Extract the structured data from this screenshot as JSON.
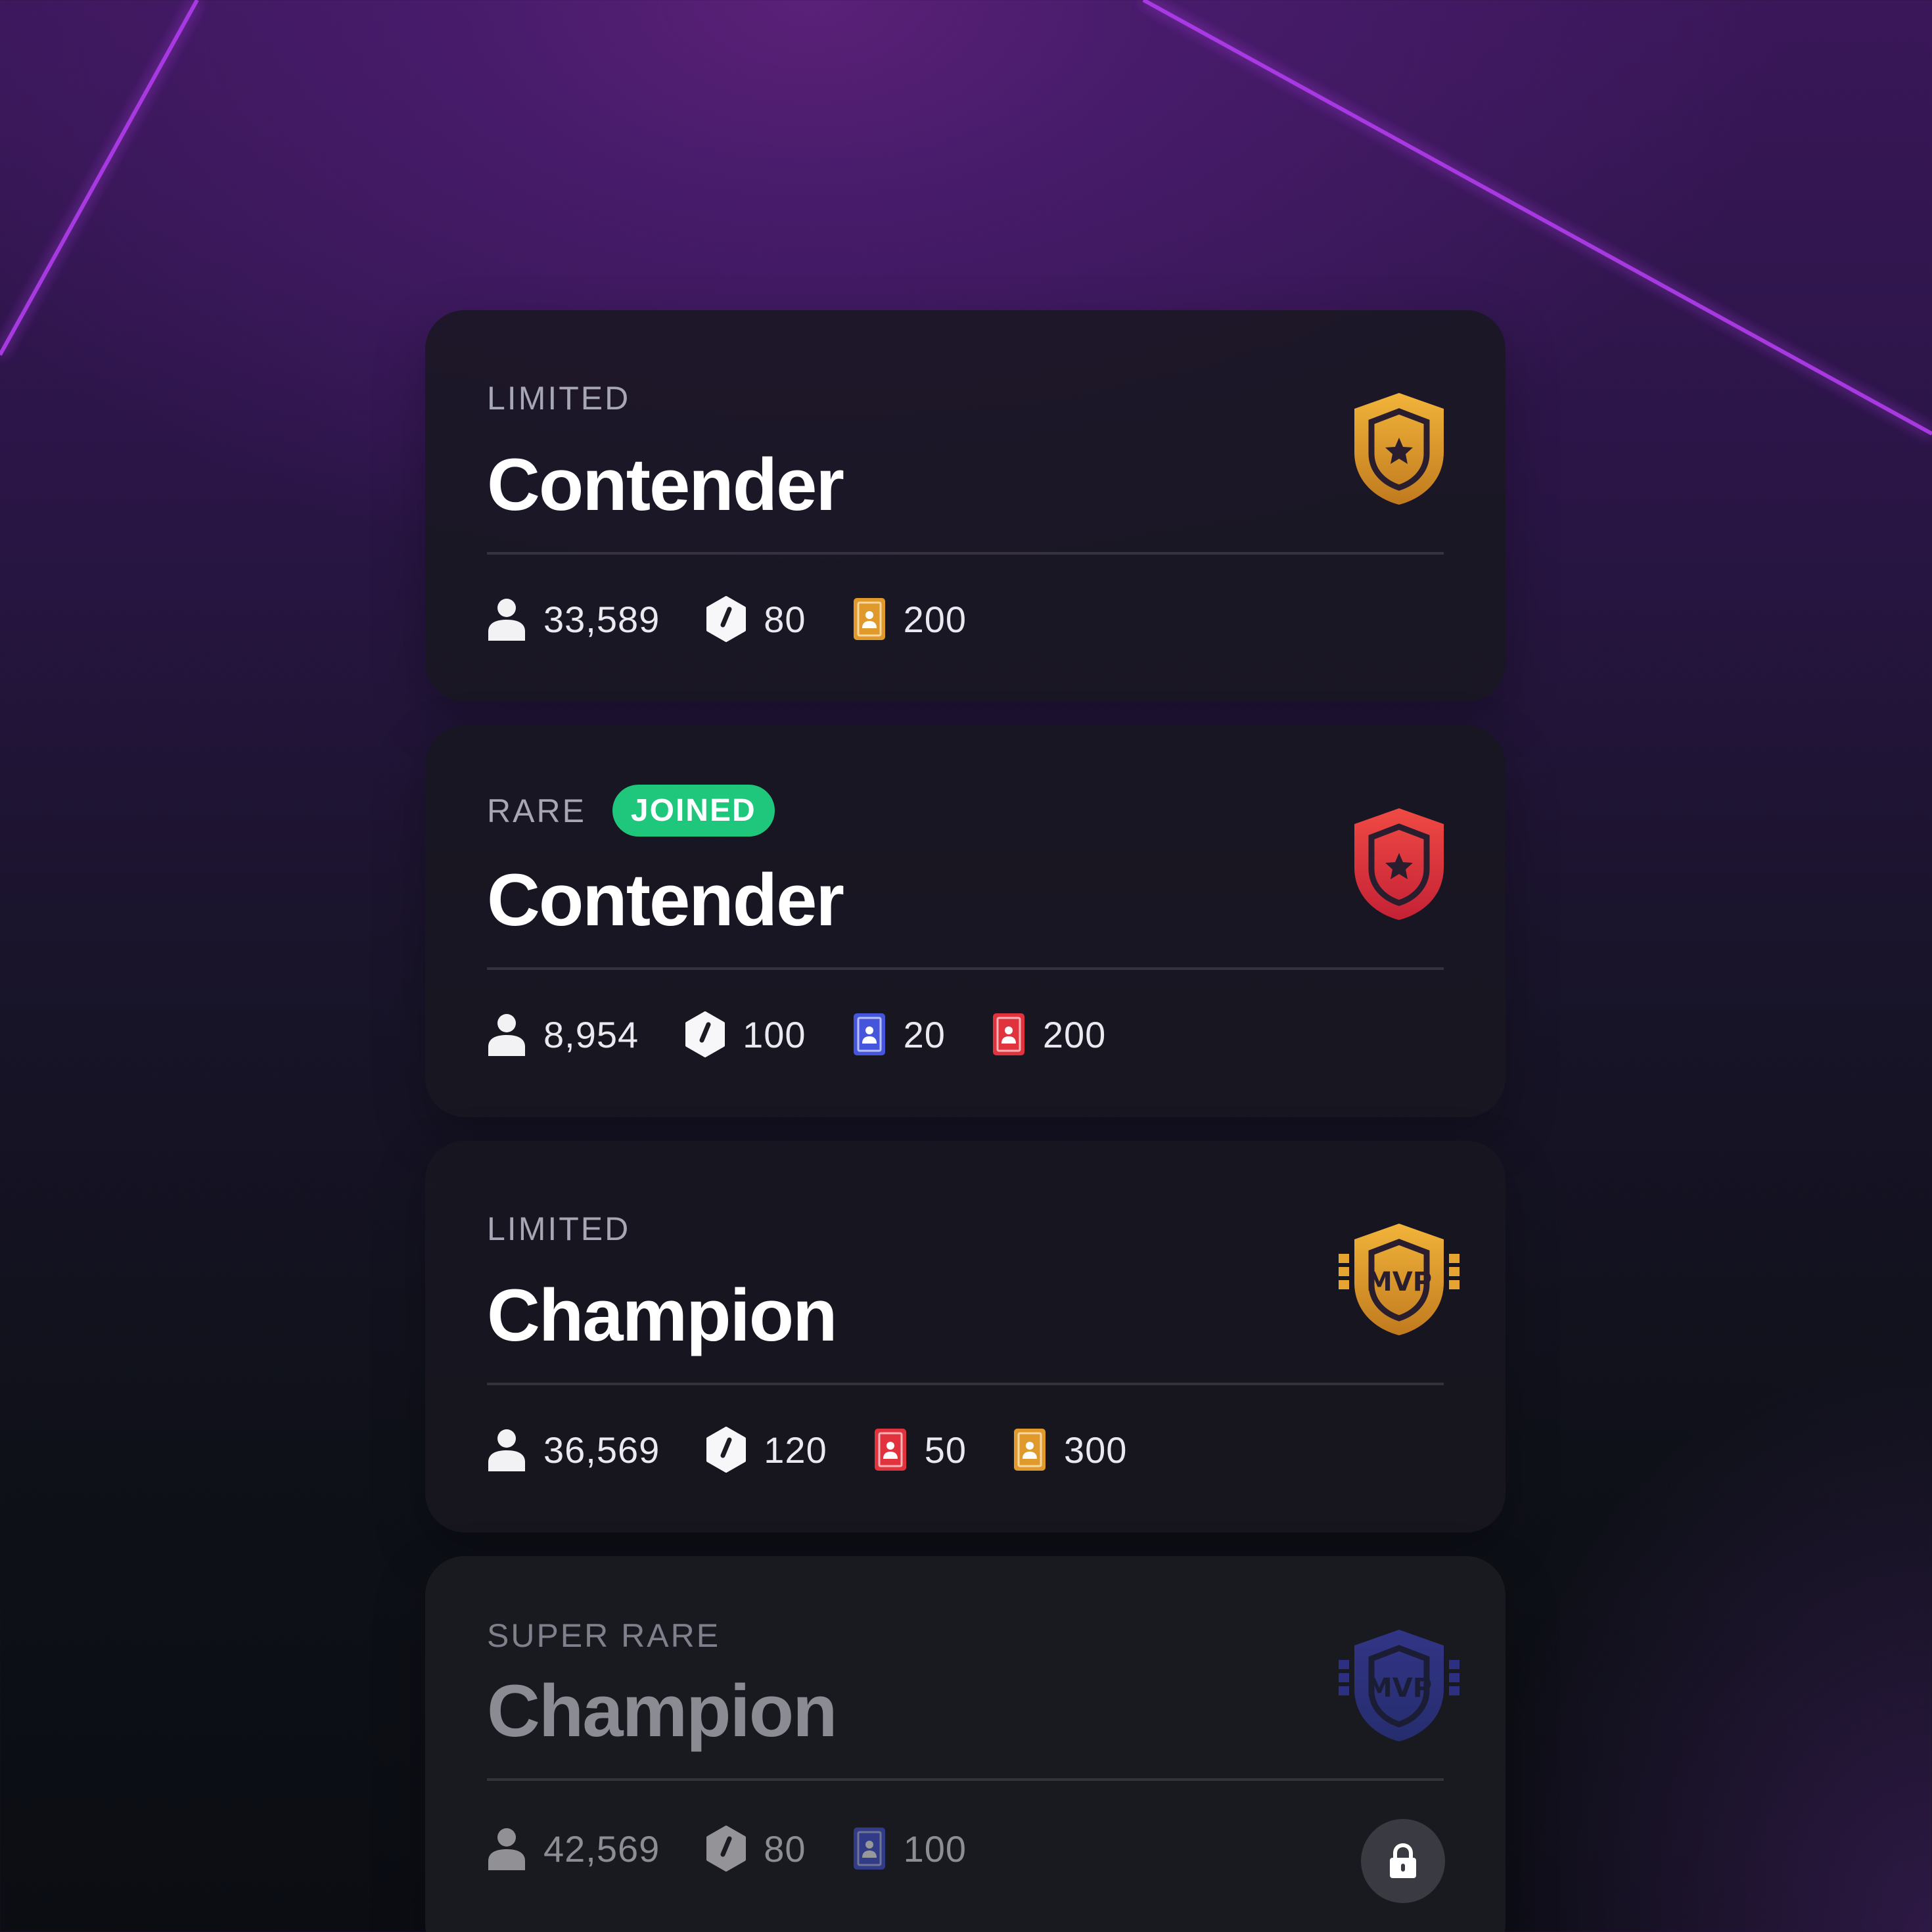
{
  "cards": [
    {
      "tier": "LIMITED",
      "title": "Contender",
      "emblem": "gold-star-shield-icon",
      "stats": [
        {
          "icon": "user-icon",
          "value": "33,589"
        },
        {
          "icon": "hexagon-icon",
          "value": "80"
        },
        {
          "icon": "gold-card-icon",
          "value": "200"
        }
      ]
    },
    {
      "tier": "RARE",
      "badge": "JOINED",
      "title": "Contender",
      "emblem": "red-star-shield-icon",
      "stats": [
        {
          "icon": "user-icon",
          "value": "8,954"
        },
        {
          "icon": "hexagon-icon",
          "value": "100"
        },
        {
          "icon": "blue-card-icon",
          "value": "20"
        },
        {
          "icon": "red-card-icon",
          "value": "200"
        }
      ]
    },
    {
      "tier": "LIMITED",
      "title": "Champion",
      "emblem": "gold-mvp-shield-icon",
      "stats": [
        {
          "icon": "user-icon",
          "value": "36,569"
        },
        {
          "icon": "hexagon-icon",
          "value": "120"
        },
        {
          "icon": "red-card-icon",
          "value": "50"
        },
        {
          "icon": "gold-card-icon",
          "value": "300"
        }
      ]
    },
    {
      "tier": "SUPER RARE",
      "title": "Champion",
      "emblem": "blue-mvp-shield-icon",
      "locked": true,
      "stats": [
        {
          "icon": "user-icon",
          "value": "42,569"
        },
        {
          "icon": "hexagon-icon",
          "value": "80"
        },
        {
          "icon": "blue-card-icon",
          "value": "100"
        }
      ]
    }
  ],
  "emblem_text": "MVP",
  "colors": {
    "joined": "#1ec77c",
    "gold": "#e0a02c",
    "red": "#e3343f",
    "blue": "#4a56e0",
    "neon": "#b23cf0"
  }
}
